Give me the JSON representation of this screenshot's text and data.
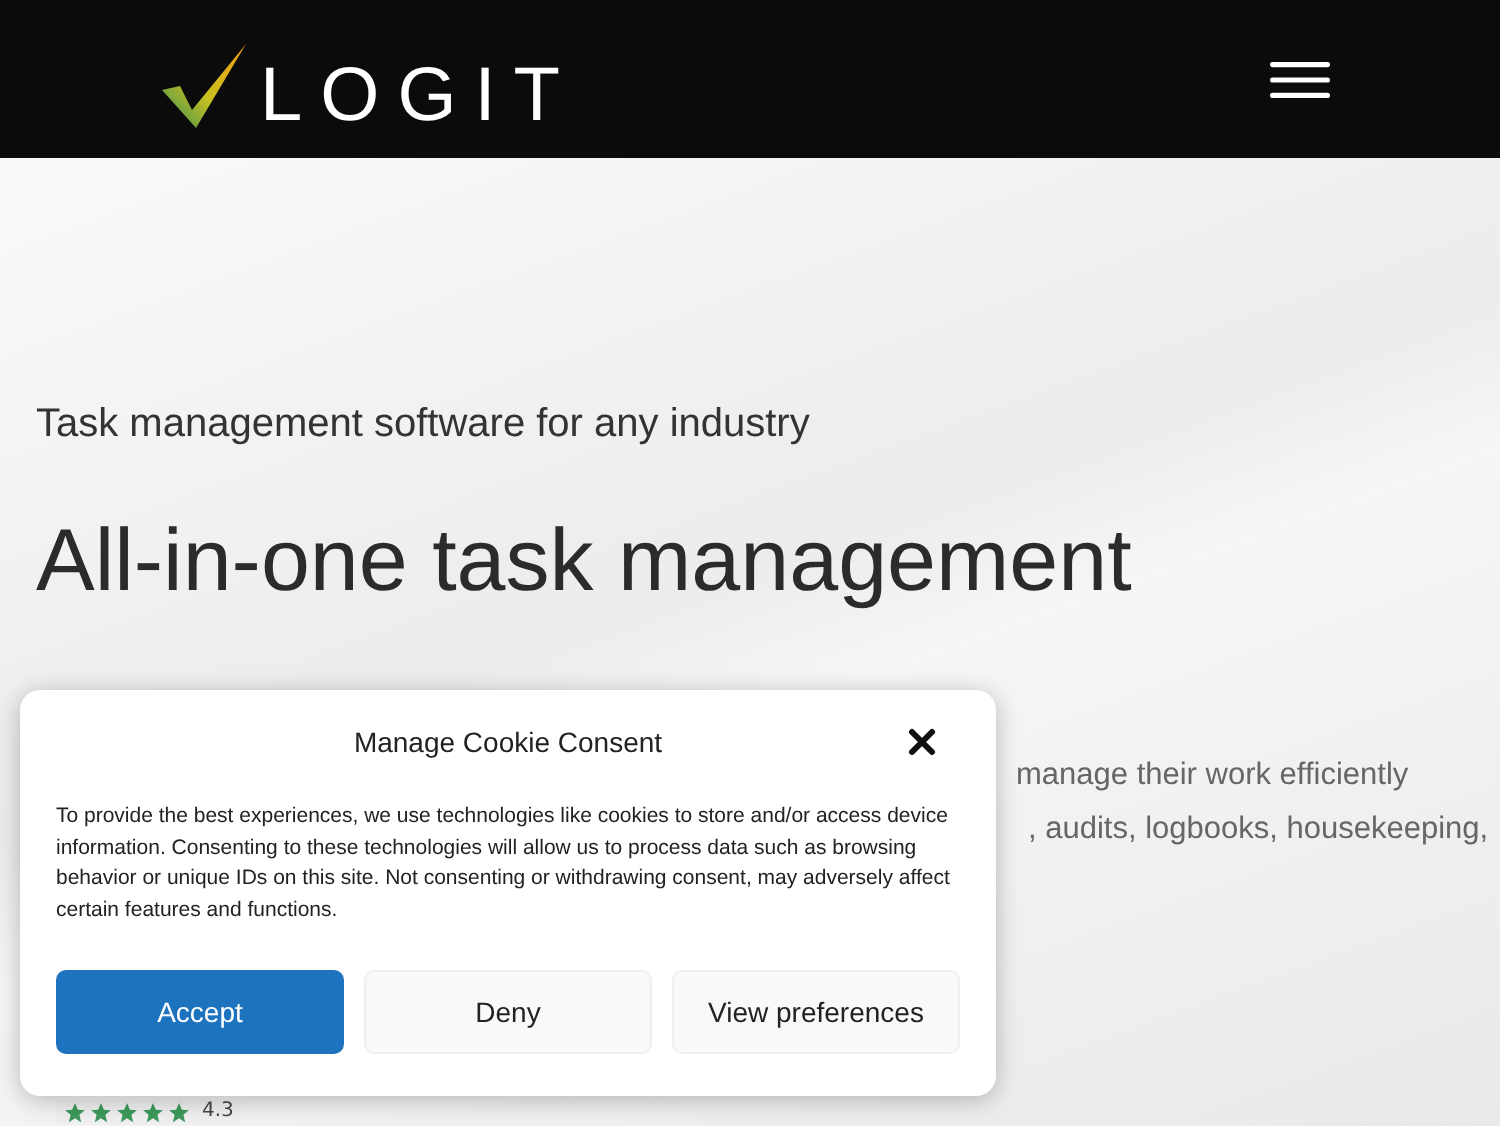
{
  "header": {
    "logo_text": "LOGIT"
  },
  "hero": {
    "subtitle": "Task management software for any industry",
    "heading": "All-in-one task management",
    "paragraph_lines": [
      "manage their work efficiently",
      ", audits, logbooks, housekeeping,"
    ],
    "rating": {
      "stars": 5,
      "score": "4.3"
    }
  },
  "cookie_dialog": {
    "title": "Manage Cookie Consent",
    "body": "To provide the best experiences, we use technologies like cookies to store and/or access device information. Consenting to these technologies will allow us to process data such as browsing behavior or unique IDs on this site. Not consenting or withdrawing consent, may adversely affect certain features and functions.",
    "buttons": [
      {
        "label": "Accept",
        "kind": "primary"
      },
      {
        "label": "Deny",
        "kind": "secondary"
      },
      {
        "label": "View preferences",
        "kind": "secondary"
      }
    ]
  }
}
